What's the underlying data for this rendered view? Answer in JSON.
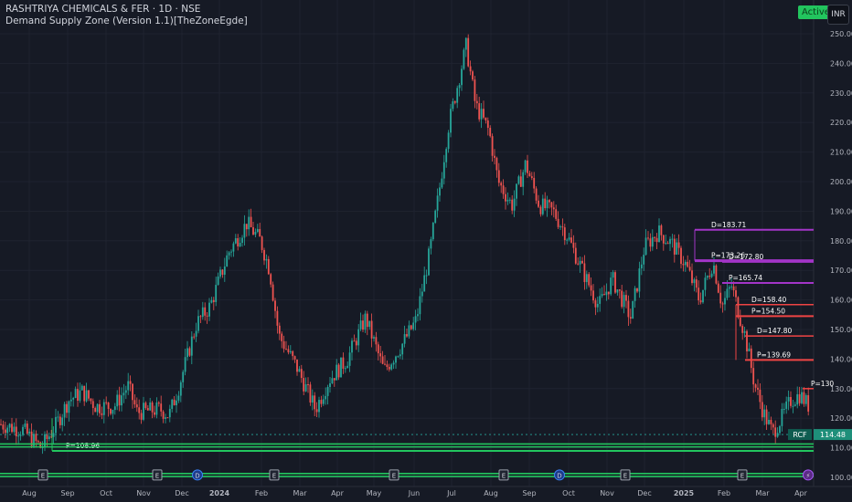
{
  "header": {
    "symbol_line": "RASHTRIYA CHEMICALS & FER · 1D · NSE",
    "indicator_line": "Demand Supply Zone (Version 1.1)[TheZoneEgde]",
    "active_label": "Active",
    "currency_label": "INR"
  },
  "price_badge": {
    "ticker": "RCF",
    "value": "114.48"
  },
  "colors": {
    "up": "#26a69a",
    "down": "#ef5350",
    "demand": "#22c55e",
    "supply": "#ef4444",
    "purple": "#a335c8",
    "bg": "#161a25",
    "grid": "#1f2330"
  },
  "chart_data": {
    "type": "candlestick",
    "title": "RASHTRIYA CHEMICALS & FER · 1D · NSE",
    "ylim": [
      97,
      256
    ],
    "y_ticks": [
      "100.00",
      "110.00",
      "120.00",
      "130.00",
      "140.00",
      "150.00",
      "160.00",
      "170.00",
      "180.00",
      "190.00",
      "200.00",
      "210.00",
      "220.00",
      "230.00",
      "240.00",
      "250.00"
    ],
    "x_ticks": [
      "Aug",
      "Sep",
      "Oct",
      "Nov",
      "Dec",
      "2024",
      "Feb",
      "Mar",
      "Apr",
      "May",
      "Jun",
      "Jul",
      "Aug",
      "Sep",
      "Oct",
      "Nov",
      "Dec",
      "2025",
      "Feb",
      "Mar",
      "Apr"
    ],
    "trend": [
      [
        0,
        118
      ],
      [
        25,
        116
      ],
      [
        45,
        110
      ],
      [
        60,
        117
      ],
      [
        75,
        126
      ],
      [
        90,
        129
      ],
      [
        105,
        124
      ],
      [
        125,
        124
      ],
      [
        140,
        131
      ],
      [
        150,
        122
      ],
      [
        175,
        123
      ],
      [
        185,
        121
      ],
      [
        195,
        130
      ],
      [
        215,
        152
      ],
      [
        230,
        158
      ],
      [
        250,
        176
      ],
      [
        270,
        186
      ],
      [
        285,
        180
      ],
      [
        295,
        170
      ],
      [
        305,
        148
      ],
      [
        325,
        137
      ],
      [
        345,
        123
      ],
      [
        360,
        133
      ],
      [
        380,
        140
      ],
      [
        400,
        154
      ],
      [
        420,
        136
      ],
      [
        440,
        145
      ],
      [
        455,
        153
      ],
      [
        470,
        176
      ],
      [
        480,
        196
      ],
      [
        490,
        218
      ],
      [
        500,
        232
      ],
      [
        510,
        246
      ],
      [
        520,
        226
      ],
      [
        535,
        217
      ],
      [
        545,
        200
      ],
      [
        560,
        192
      ],
      [
        575,
        206
      ],
      [
        590,
        192
      ],
      [
        605,
        190
      ],
      [
        620,
        182
      ],
      [
        640,
        168
      ],
      [
        655,
        158
      ],
      [
        670,
        167
      ],
      [
        690,
        154
      ],
      [
        705,
        178
      ],
      [
        720,
        183
      ],
      [
        735,
        179
      ],
      [
        750,
        172
      ],
      [
        765,
        160
      ],
      [
        780,
        173
      ],
      [
        790,
        158
      ],
      [
        800,
        165
      ],
      [
        815,
        148
      ],
      [
        825,
        132
      ],
      [
        835,
        122
      ],
      [
        845,
        115
      ],
      [
        855,
        120
      ],
      [
        865,
        126
      ],
      [
        875,
        128
      ],
      [
        885,
        124
      ]
    ],
    "zones": [
      {
        "label": "D=183.71",
        "price": 183.71,
        "kind": "purple"
      },
      {
        "label": "P=173.26",
        "price": 173.26,
        "kind": "purple"
      },
      {
        "label": "D=172.80",
        "price": 172.8,
        "kind": "purple"
      },
      {
        "label": "P=165.74",
        "price": 165.74,
        "kind": "purple"
      },
      {
        "label": "D=158.40",
        "price": 158.4,
        "kind": "supply"
      },
      {
        "label": "P=154.50",
        "price": 154.5,
        "kind": "supply"
      },
      {
        "label": "D=147.80",
        "price": 147.8,
        "kind": "supply"
      },
      {
        "label": "P=139.69",
        "price": 139.69,
        "kind": "supply"
      },
      {
        "label": "P=108.96",
        "price": 108.96,
        "kind": "demand"
      },
      {
        "label": "P=130",
        "price": 130,
        "kind": "supply"
      }
    ],
    "last_price": 114.48,
    "event_markers": [
      "E",
      "E",
      "E",
      "D",
      "E",
      "E",
      "E",
      "D",
      "E",
      "E",
      "⚡"
    ]
  }
}
